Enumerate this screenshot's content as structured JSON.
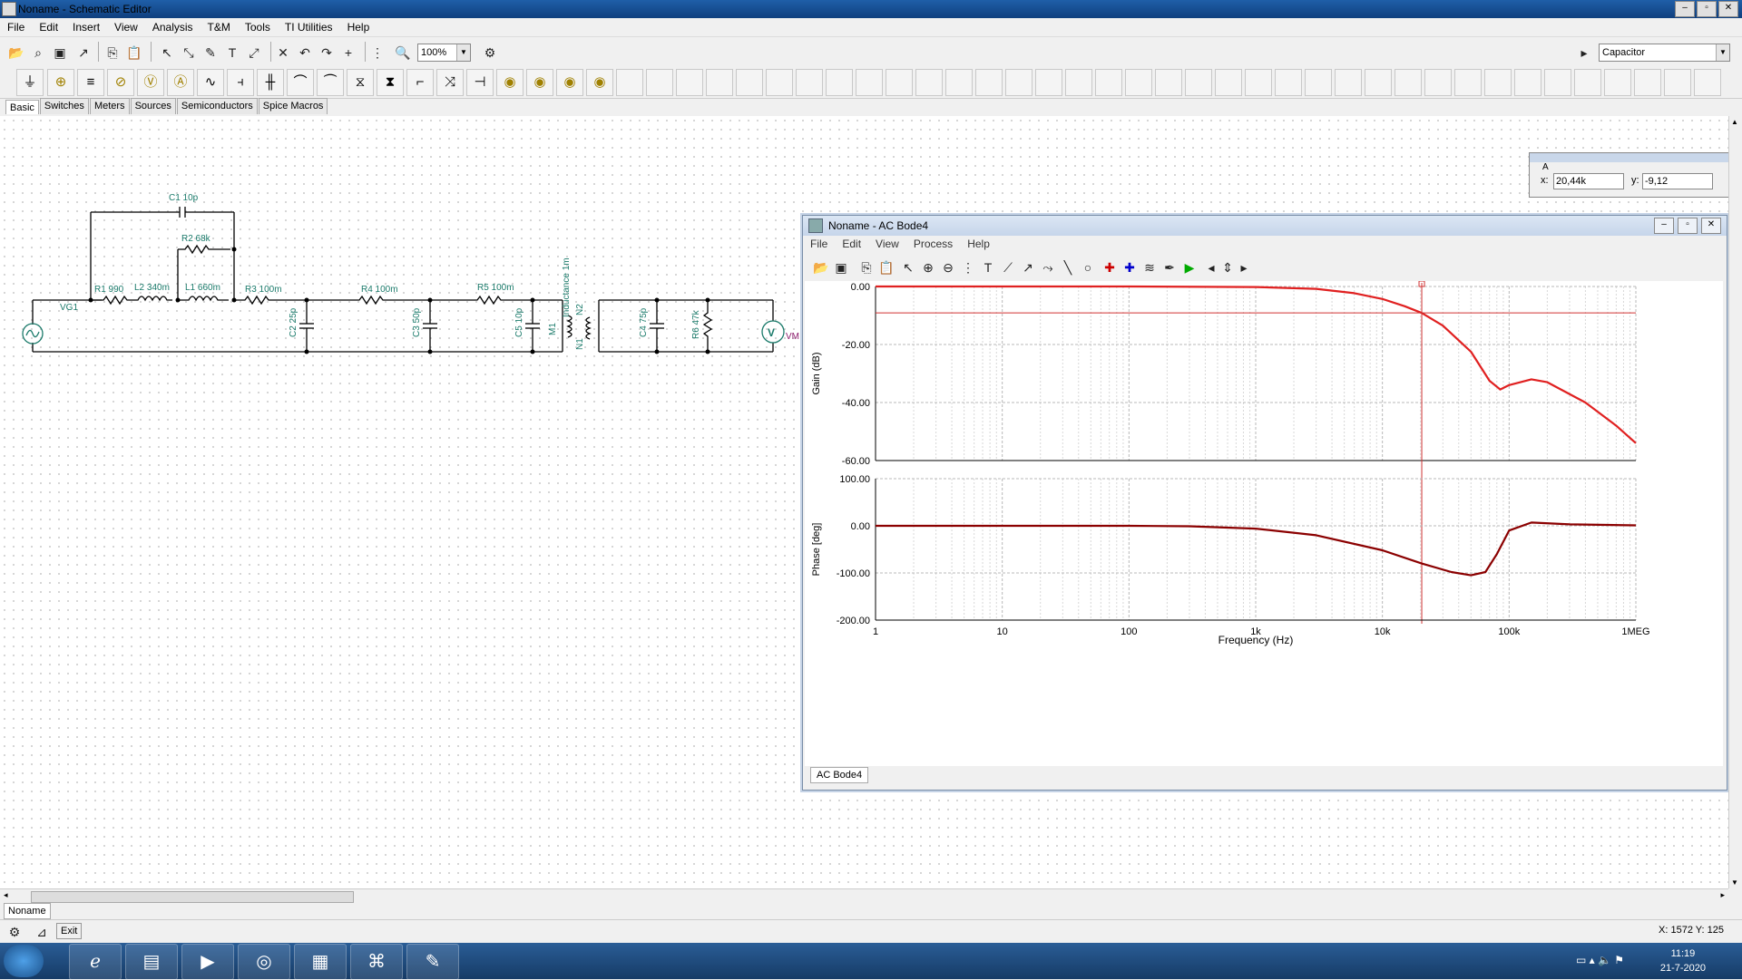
{
  "window": {
    "title": "Noname - Schematic Editor",
    "controls": [
      "–",
      "▫",
      "✕"
    ]
  },
  "menu": [
    "File",
    "Edit",
    "Insert",
    "View",
    "Analysis",
    "T&M",
    "Tools",
    "TI Utilities",
    "Help"
  ],
  "toolbar": {
    "zoom_value": "100%",
    "component_value": "Capacitor"
  },
  "component_tabs": [
    "Basic",
    "Switches",
    "Meters",
    "Sources",
    "Semiconductors",
    "Spice Macros"
  ],
  "schematic": {
    "labels": {
      "vg1": "VG1",
      "c1": "C1 10p",
      "r2": "R2 68k",
      "r1": "R1 990",
      "l2": "L2 340m",
      "l1": "L1 660m",
      "r3": "R3 100m",
      "r4": "R4 100m",
      "r5": "R5 100m",
      "c2": "C2 25p",
      "c3": "C3 50p",
      "c5": "C5 10p",
      "m1": "M1",
      "inductance": "Inductance 1m",
      "n2": "N2",
      "n1": "N1",
      "c4": "C4 75p",
      "r6": "R6 47k",
      "vm": "VM",
      "v_symbol": "V"
    }
  },
  "cursor_readout": {
    "label": "A",
    "x_label": "x:",
    "x_value": "20,44k",
    "y_label": "y:",
    "y_value": "-9,12"
  },
  "bode_window": {
    "title": "Noname - AC Bode4",
    "menu": [
      "File",
      "Edit",
      "View",
      "Process",
      "Help"
    ],
    "tab": "AC Bode4"
  },
  "chart_data": [
    {
      "type": "line",
      "title": "",
      "xlabel": "Frequency (Hz)",
      "ylabel": "Gain (dB)",
      "xscale": "log",
      "xlim": [
        1,
        1000000
      ],
      "ylim": [
        -60,
        0
      ],
      "xticks": [
        "1",
        "10",
        "100",
        "1k",
        "10k",
        "100k",
        "1MEG"
      ],
      "yticks": [
        "0.00",
        "-20.00",
        "-40.00",
        "-60.00"
      ],
      "grid": true,
      "cursor": {
        "x": 20440,
        "y": -9.12
      },
      "series": [
        {
          "color": "#e02020",
          "x": [
            1,
            100,
            1000,
            3000,
            6000,
            10000,
            15000,
            20440,
            30000,
            50000,
            70000,
            85000,
            100000,
            150000,
            200000,
            400000,
            700000,
            1000000
          ],
          "y": [
            0,
            0,
            -0.2,
            -0.8,
            -2.3,
            -4.3,
            -6.8,
            -9.12,
            -13.5,
            -22.5,
            -32.5,
            -35.5,
            -34,
            -32,
            -33,
            -40,
            -48,
            -54
          ]
        }
      ]
    },
    {
      "type": "line",
      "title": "",
      "xlabel": "Frequency (Hz)",
      "ylabel": "Phase [deg]",
      "xscale": "log",
      "xlim": [
        1,
        1000000
      ],
      "ylim": [
        -200,
        100
      ],
      "xticks": [
        "1",
        "10",
        "100",
        "1k",
        "10k",
        "100k",
        "1MEG"
      ],
      "yticks": [
        "100.00",
        "0.00",
        "-100.00",
        "-200.00"
      ],
      "grid": true,
      "series": [
        {
          "color": "#8b0000",
          "x": [
            1,
            100,
            300,
            1000,
            3000,
            10000,
            20440,
            35000,
            50000,
            65000,
            80000,
            100000,
            150000,
            300000,
            1000000
          ],
          "y": [
            0,
            0,
            -1,
            -6,
            -20,
            -52,
            -80,
            -98,
            -105,
            -98,
            -60,
            -10,
            7,
            3,
            1
          ]
        }
      ]
    }
  ],
  "status": {
    "coords": "X: 1572  Y: 125",
    "doc_tab": "Noname",
    "exit": "Exit"
  },
  "taskbar": {
    "time": "11:19",
    "date": "21-7-2020"
  }
}
